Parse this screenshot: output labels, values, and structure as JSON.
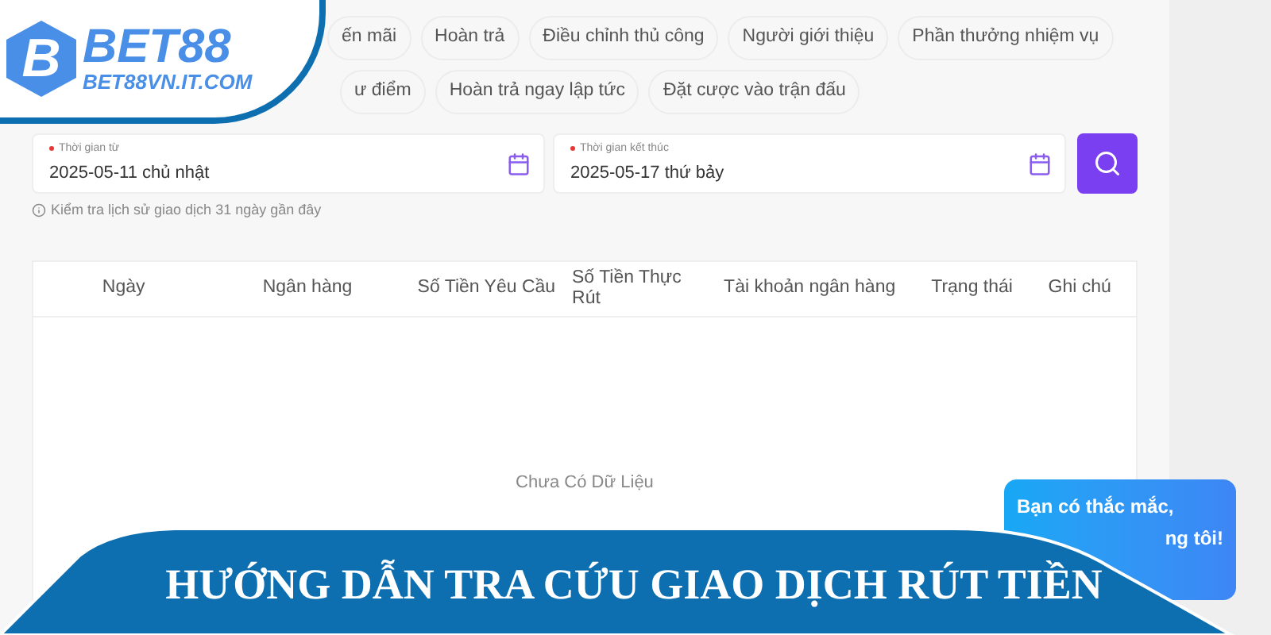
{
  "logo": {
    "mark": "B",
    "name": "BET88",
    "domain": "BET88VN.IT.COM"
  },
  "filter_rows": [
    {
      "tabs": [
        {
          "label": "ến mãi"
        },
        {
          "label": "Hoàn trả"
        },
        {
          "label": "Điều chỉnh thủ công"
        },
        {
          "label": "Người giới thiệu"
        },
        {
          "label": "Phần thưởng nhiệm vụ"
        }
      ]
    },
    {
      "tabs": [
        {
          "label": "ư điểm"
        },
        {
          "label": "Hoàn trả ngay lập tức"
        },
        {
          "label": "Đặt cược vào trận đấu"
        }
      ]
    }
  ],
  "date_range": [
    {
      "label": "Thời gian từ",
      "required": true,
      "value": "2025-05-11 chủ nhật"
    },
    {
      "label": "Thời gian kết thúc",
      "required": true,
      "value": "2025-05-17 thứ bảy"
    }
  ],
  "hint": "Kiểm tra lịch sử giao dịch 31 ngày gần đây",
  "table": {
    "columns": [
      "Ngày",
      "Ngân hàng",
      "Số Tiền Yêu Cầu",
      "Số Tiền Thực Rút",
      "Tài khoản ngân hàng",
      "Trạng thái",
      "Ghi chú"
    ],
    "empty_text": "Chưa Có Dữ Liệu"
  },
  "chat_bubble": {
    "lines": [
      "Bạn có thắc mắc,",
      "ng tôi!"
    ]
  },
  "banner": {
    "title": "HƯỚNG DẪN TRA CỨU GIAO DỊCH RÚT TIỀN"
  }
}
